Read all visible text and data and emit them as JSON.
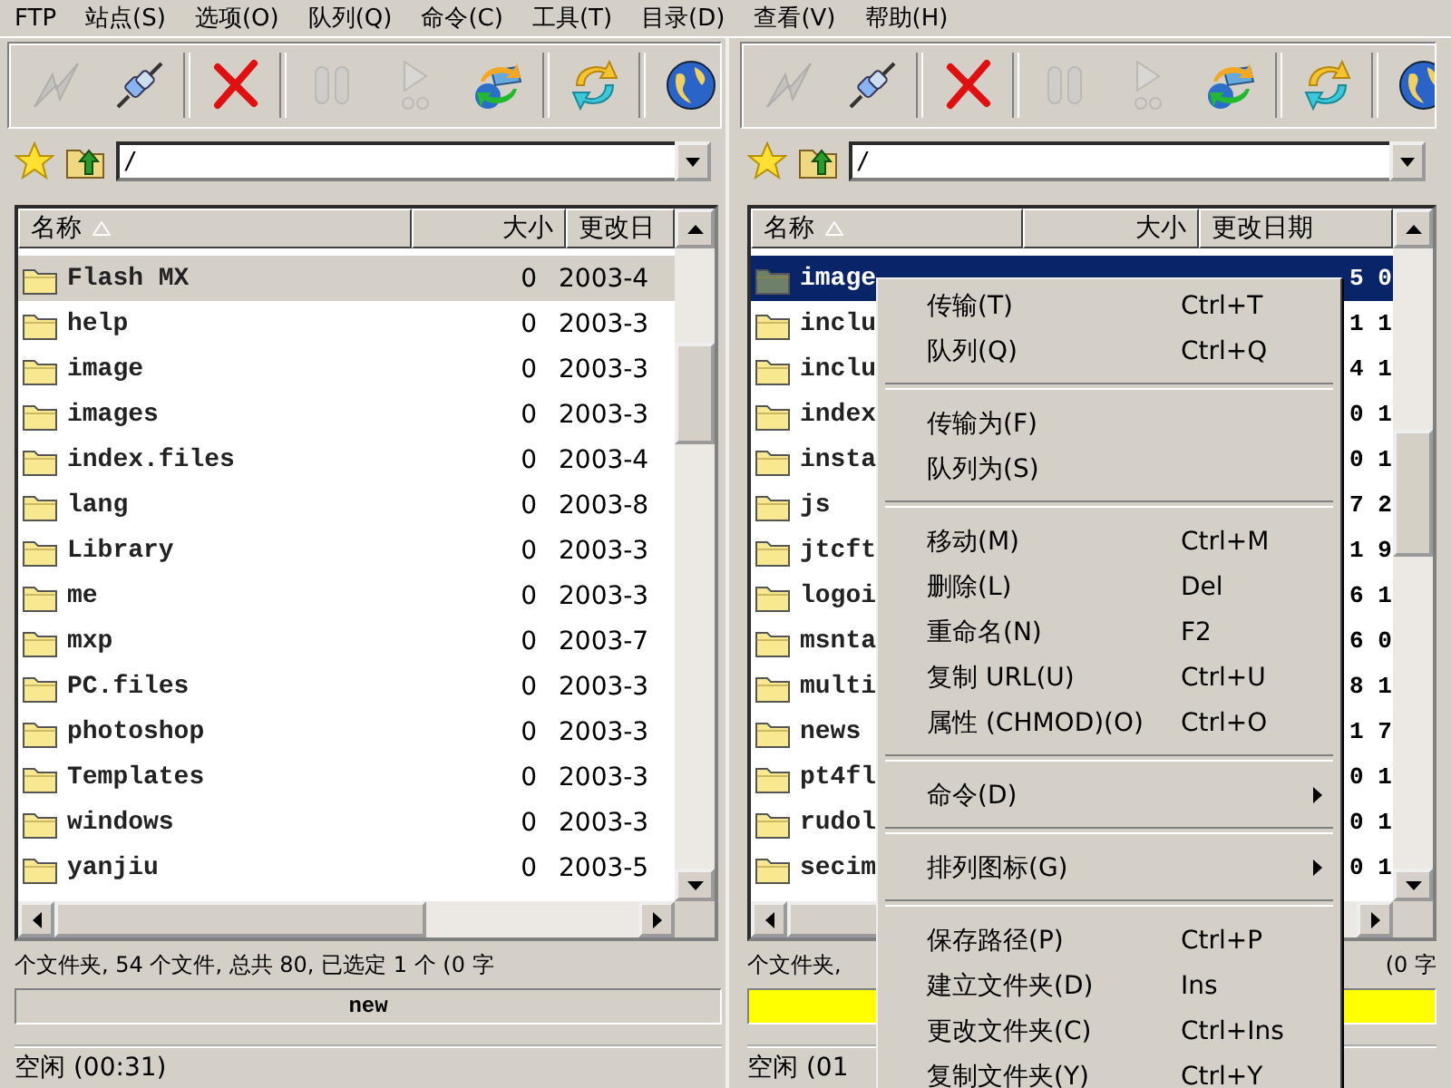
{
  "menu_bar": [
    "FTP",
    "站点(S)",
    "选项(O)",
    "队列(Q)",
    "命令(C)",
    "工具(T)",
    "目录(D)",
    "查看(V)",
    "帮助(H)"
  ],
  "panes": [
    {
      "active": false,
      "toolbar": [
        {
          "kind": "lightning",
          "disabled": true
        },
        {
          "kind": "plug",
          "disabled": false
        },
        {
          "kind": "sep"
        },
        {
          "kind": "cross",
          "disabled": false
        },
        {
          "kind": "sep"
        },
        {
          "kind": "pause",
          "disabled": true
        },
        {
          "kind": "play",
          "disabled": true
        },
        {
          "kind": "transfer",
          "disabled": false
        },
        {
          "kind": "sep"
        },
        {
          "kind": "refresh",
          "disabled": false
        },
        {
          "kind": "sep"
        },
        {
          "kind": "globe",
          "disabled": false
        }
      ],
      "path": "/",
      "columns": [
        "名称",
        "大小",
        "更改日"
      ],
      "rows": [
        {
          "name": "Flash MX",
          "size": "0",
          "date": "2003-4",
          "selected": true
        },
        {
          "name": "help",
          "size": "0",
          "date": "2003-3",
          "selected": false
        },
        {
          "name": "image",
          "size": "0",
          "date": "2003-3",
          "selected": false
        },
        {
          "name": "images",
          "size": "0",
          "date": "2003-3",
          "selected": false
        },
        {
          "name": "index.files",
          "size": "0",
          "date": "2003-4",
          "selected": false
        },
        {
          "name": "lang",
          "size": "0",
          "date": "2003-8",
          "selected": false
        },
        {
          "name": "Library",
          "size": "0",
          "date": "2003-3",
          "selected": false
        },
        {
          "name": "me",
          "size": "0",
          "date": "2003-3",
          "selected": false
        },
        {
          "name": "mxp",
          "size": "0",
          "date": "2003-7",
          "selected": false
        },
        {
          "name": "PC.files",
          "size": "0",
          "date": "2003-3",
          "selected": false
        },
        {
          "name": "photoshop",
          "size": "0",
          "date": "2003-3",
          "selected": false
        },
        {
          "name": "Templates",
          "size": "0",
          "date": "2003-3",
          "selected": false
        },
        {
          "name": "windows",
          "size": "0",
          "date": "2003-3",
          "selected": false
        },
        {
          "name": "yanjiu",
          "size": "0",
          "date": "2003-5",
          "selected": false
        }
      ],
      "summary": [
        "个文件夹, 54 个文件, 总共 80, 已选定 1 个 (0 字"
      ],
      "bar": {
        "label": "new",
        "busy": false
      },
      "status": "空闲 (00:31)"
    },
    {
      "active": true,
      "toolbar": [
        {
          "kind": "lightning",
          "disabled": true
        },
        {
          "kind": "plug",
          "disabled": false
        },
        {
          "kind": "sep"
        },
        {
          "kind": "cross",
          "disabled": false
        },
        {
          "kind": "sep"
        },
        {
          "kind": "pause",
          "disabled": true
        },
        {
          "kind": "play",
          "disabled": true
        },
        {
          "kind": "transfer",
          "disabled": false
        },
        {
          "kind": "sep"
        },
        {
          "kind": "refresh",
          "disabled": false
        },
        {
          "kind": "sep"
        },
        {
          "kind": "globe",
          "disabled": false
        }
      ],
      "path": "/",
      "columns": [
        "名称",
        "大小",
        "更改日期"
      ],
      "rows": [
        {
          "name": "image",
          "date_tail": "5 0",
          "selected": true
        },
        {
          "name": "inclu",
          "date_tail": "1 1",
          "selected": false
        },
        {
          "name": "inclu",
          "date_tail": "4 1",
          "selected": false
        },
        {
          "name": "index",
          "date_tail": "0 1",
          "selected": false
        },
        {
          "name": "insta",
          "date_tail": "0 1",
          "selected": false
        },
        {
          "name": "js",
          "date_tail": "7 2",
          "selected": false
        },
        {
          "name": "jtcft",
          "date_tail": "1 9",
          "selected": false
        },
        {
          "name": "logoi",
          "date_tail": "6 1",
          "selected": false
        },
        {
          "name": "msnta",
          "date_tail": "6 0",
          "selected": false
        },
        {
          "name": "multi",
          "date_tail": "8 1",
          "selected": false
        },
        {
          "name": "news",
          "date_tail": "1 7",
          "selected": false
        },
        {
          "name": "pt4fl",
          "date_tail": "0 1",
          "selected": false
        },
        {
          "name": "rudol",
          "date_tail": "0 1",
          "selected": false
        },
        {
          "name": "secim",
          "date_tail": "0 1",
          "selected": false
        }
      ],
      "summary": [
        "个文件夹,",
        "(0 字"
      ],
      "bar": {
        "busy": true
      },
      "status": "空闲 (01"
    }
  ],
  "context_menu": [
    {
      "kind": "item",
      "label": "传输(T)",
      "shortcut": "Ctrl+T"
    },
    {
      "kind": "item",
      "label": "队列(Q)",
      "shortcut": "Ctrl+Q"
    },
    {
      "kind": "separator"
    },
    {
      "kind": "item",
      "label": "传输为(F)"
    },
    {
      "kind": "item",
      "label": "队列为(S)"
    },
    {
      "kind": "separator"
    },
    {
      "kind": "item",
      "label": "移动(M)",
      "shortcut": "Ctrl+M"
    },
    {
      "kind": "item",
      "label": "删除(L)",
      "shortcut": "Del"
    },
    {
      "kind": "item",
      "label": "重命名(N)",
      "shortcut": "F2"
    },
    {
      "kind": "item",
      "label": "复制 URL(U)",
      "shortcut": "Ctrl+U"
    },
    {
      "kind": "item",
      "label": "属性 (CHMOD)(O)",
      "shortcut": "Ctrl+O"
    },
    {
      "kind": "separator"
    },
    {
      "kind": "submenu",
      "label": "命令(D)"
    },
    {
      "kind": "separator"
    },
    {
      "kind": "submenu",
      "label": "排列图标(G)"
    },
    {
      "kind": "separator"
    },
    {
      "kind": "item",
      "label": "保存路径(P)",
      "shortcut": "Ctrl+P"
    },
    {
      "kind": "item",
      "label": "建立文件夹(D)",
      "shortcut": "Ins"
    },
    {
      "kind": "item",
      "label": "更改文件夹(C)",
      "shortcut": "Ctrl+Ins"
    },
    {
      "kind": "item",
      "label": "复制文件夹(Y)",
      "shortcut": "Ctrl+Y"
    }
  ]
}
